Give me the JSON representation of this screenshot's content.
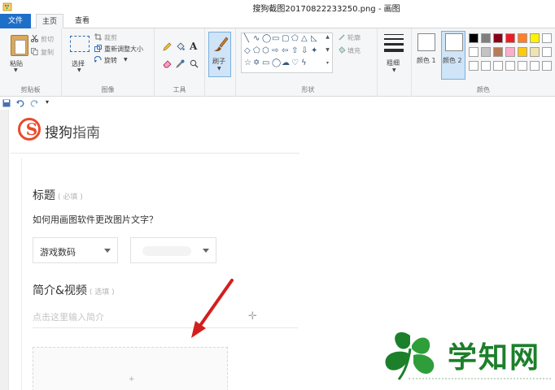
{
  "window": {
    "title": "搜狗截图20170822233250.png - 画图"
  },
  "ribbon_tabs": {
    "file": "文件",
    "home": "主页",
    "view": "查看"
  },
  "clipboard": {
    "paste": "粘贴",
    "cut": "剪切",
    "copy": "复制",
    "group_label": "剪贴板"
  },
  "image": {
    "select": "选择",
    "crop": "裁剪",
    "resize": "重新调整大小",
    "rotate": "旋转",
    "group_label": "图像"
  },
  "tools": {
    "group_label": "工具"
  },
  "brushes": {
    "label": "刷子"
  },
  "shapes": {
    "outline": "轮廓",
    "fill": "填充",
    "group_label": "形状"
  },
  "size": {
    "label": "粗细"
  },
  "colors": {
    "color1": "颜色 1",
    "color2": "颜色 2",
    "group_label": "颜色",
    "palette": [
      "#000000",
      "#7f7f7f",
      "#880015",
      "#ed1c24",
      "#ff7f27",
      "#fff200",
      "#ffffff",
      "#c3c3c3",
      "#b97a57",
      "#ffaec9",
      "#ffc90e",
      "#efe4b0"
    ]
  },
  "page": {
    "logo_letter": "S",
    "guide_brand": "搜狗",
    "guide_word": "指南",
    "title_label": "标题",
    "title_hint": "( 必填 )",
    "title_value": "如何用画图软件更改图片文字？",
    "category1": "游戏数码",
    "intro_label": "简介&视频",
    "intro_hint": "( 选填 )",
    "intro_placeholder": "点击这里输入简介"
  },
  "watermark": {
    "name": "学知网"
  }
}
